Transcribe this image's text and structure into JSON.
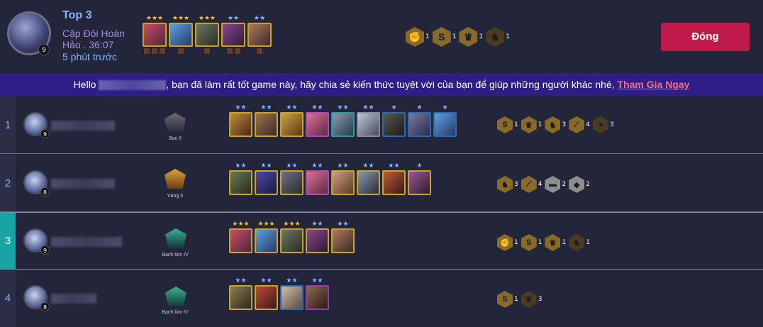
{
  "header": {
    "title": "Top 3",
    "mode": "Cặp Đôi Hoàn Hảo . 36:07",
    "time_ago": "5 phút trước",
    "level": "9",
    "units": [
      {
        "stars": "★★★",
        "tier": "gold"
      },
      {
        "stars": "★★★",
        "tier": "gold"
      },
      {
        "stars": "★★★",
        "tier": "gold"
      },
      {
        "stars": "★★",
        "tier": "silver"
      },
      {
        "stars": "★★",
        "tier": "silver"
      }
    ],
    "traits": [
      {
        "count": "1",
        "icon": "fist-icon"
      },
      {
        "count": "1",
        "icon": "swirl-icon"
      },
      {
        "count": "1",
        "icon": "crown-icon"
      },
      {
        "count": "1",
        "icon": "figure-icon"
      }
    ],
    "close_label": "Đóng"
  },
  "banner": {
    "greeting": "Hello",
    "message": ", bạn đã làm rất tốt game này, hãy chia sẻ kiến thức tuyệt vời của bạn để giúp những người khác nhé,",
    "link": "Tham Gia Ngay"
  },
  "rows": [
    {
      "rank": "1",
      "level": "9",
      "rank_label": "Bạc II",
      "units": [
        "★★",
        "★★",
        "★★",
        "★★",
        "★★",
        "★★",
        "★",
        "★",
        "★"
      ],
      "traits": [
        {
          "count": "1"
        },
        {
          "count": "1"
        },
        {
          "count": "3"
        },
        {
          "count": "4"
        },
        {
          "count": "3"
        }
      ]
    },
    {
      "rank": "2",
      "level": "8",
      "rank_label": "Vàng II",
      "units": [
        "★★",
        "★★",
        "★★",
        "★★",
        "★★",
        "★★",
        "★★",
        "★"
      ],
      "traits": [
        {
          "count": "3"
        },
        {
          "count": "4"
        },
        {
          "count": "2"
        },
        {
          "count": "2"
        }
      ]
    },
    {
      "rank": "3",
      "level": "9",
      "rank_label": "Bạch kim IV",
      "units": [
        "★★★",
        "★★★",
        "★★★",
        "★★",
        "★★"
      ],
      "traits": [
        {
          "count": "1"
        },
        {
          "count": "1"
        },
        {
          "count": "1"
        },
        {
          "count": "1"
        }
      ]
    },
    {
      "rank": "4",
      "level": "8",
      "rank_label": "Bạch kim IV",
      "units": [
        "★★",
        "★★",
        "★★",
        "★★"
      ],
      "traits": [
        {
          "count": "1"
        },
        {
          "count": "3"
        }
      ]
    }
  ]
}
